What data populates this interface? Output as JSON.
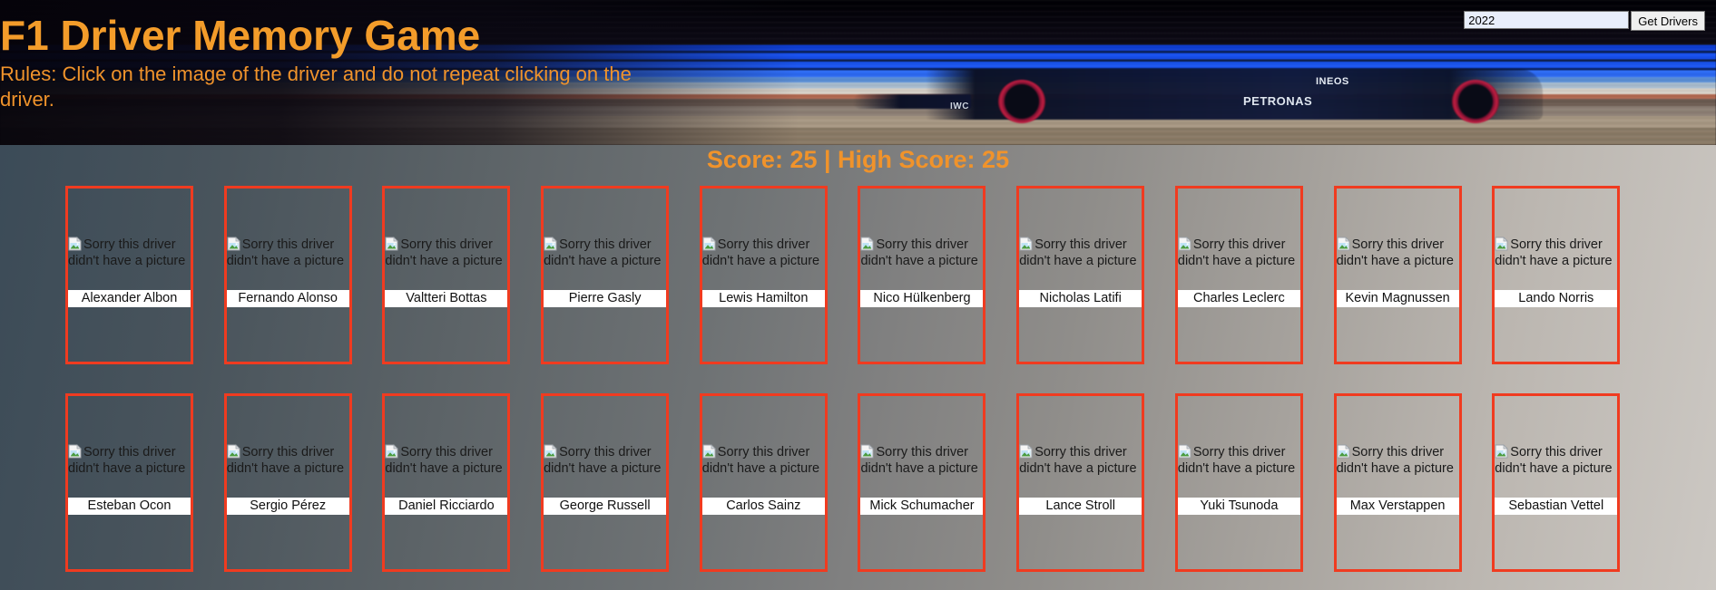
{
  "header": {
    "title": "F1 Driver Memory Game",
    "rules": "Rules: Click on the image of the driver and do not repeat clicking on the driver.",
    "hero_labels": {
      "petronas": "PETRONAS",
      "ineos": "INEOS",
      "iwc": "IWC"
    }
  },
  "controls": {
    "year_value": "2022",
    "year_placeholder": "",
    "get_drivers_label": "Get Drivers"
  },
  "score": {
    "text": "Score: 25 | High Score: 25",
    "current": 25,
    "high": 25
  },
  "colors": {
    "accent_orange": "#f0932b",
    "title_orange": "#f39c2a",
    "card_border_red": "#f03b20",
    "name_tag_bg": "#ffffff"
  },
  "cards": {
    "image_alt": "Sorry this driver didn't have a picture",
    "drivers": [
      {
        "name": "Alexander Albon"
      },
      {
        "name": "Fernando Alonso"
      },
      {
        "name": "Valtteri Bottas"
      },
      {
        "name": "Pierre Gasly"
      },
      {
        "name": "Lewis Hamilton"
      },
      {
        "name": "Nico Hülkenberg"
      },
      {
        "name": "Nicholas Latifi"
      },
      {
        "name": "Charles Leclerc"
      },
      {
        "name": "Kevin Magnussen"
      },
      {
        "name": "Lando Norris"
      },
      {
        "name": "Esteban Ocon"
      },
      {
        "name": "Sergio Pérez"
      },
      {
        "name": "Daniel Ricciardo"
      },
      {
        "name": "George Russell"
      },
      {
        "name": "Carlos Sainz"
      },
      {
        "name": "Mick Schumacher"
      },
      {
        "name": "Lance Stroll"
      },
      {
        "name": "Yuki Tsunoda"
      },
      {
        "name": "Max Verstappen"
      },
      {
        "name": "Sebastian Vettel"
      }
    ]
  }
}
